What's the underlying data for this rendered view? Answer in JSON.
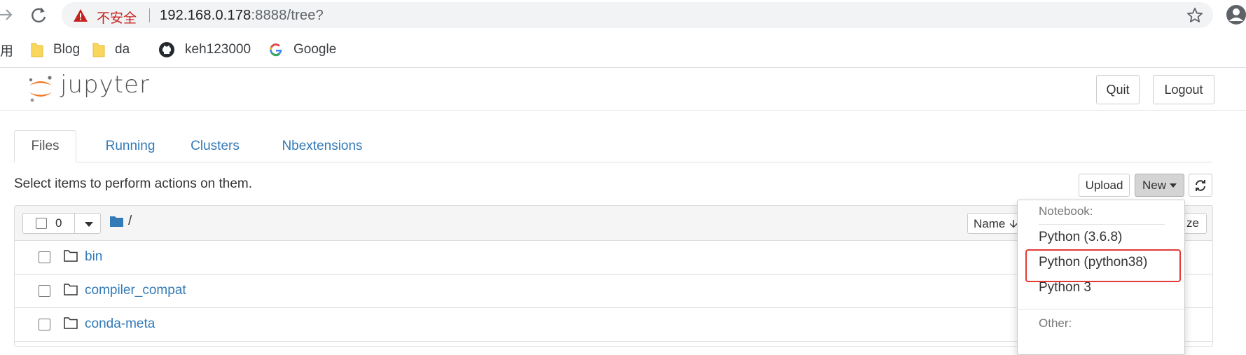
{
  "browser": {
    "security_label": "不安全",
    "url_host": "192.168.0.178",
    "url_rest": ":8888/tree?",
    "bookmarks": [
      {
        "label": "用",
        "icon": "apps-icon"
      },
      {
        "label": "Blog",
        "icon": "folder-icon"
      },
      {
        "label": "da",
        "icon": "folder-icon"
      },
      {
        "label": "keh123000",
        "icon": "github-icon"
      },
      {
        "label": "Google",
        "icon": "google-icon"
      }
    ]
  },
  "header": {
    "logo_text": "jupyter",
    "quit_label": "Quit",
    "logout_label": "Logout"
  },
  "tabs": [
    {
      "label": "Files",
      "active": true
    },
    {
      "label": "Running",
      "active": false
    },
    {
      "label": "Clusters",
      "active": false
    },
    {
      "label": "Nbextensions",
      "active": false
    }
  ],
  "toolbar": {
    "hint": "Select items to perform actions on them.",
    "upload_label": "Upload",
    "new_label": "New"
  },
  "list_header": {
    "selected_count": "0",
    "breadcrumb": "/",
    "name_label": "Name",
    "size_label": "ze"
  },
  "files": [
    {
      "name": "bin"
    },
    {
      "name": "compiler_compat"
    },
    {
      "name": "conda-meta"
    }
  ],
  "new_menu": {
    "notebook_header": "Notebook:",
    "kernels": [
      "Python (3.6.8)",
      "Python (python38)",
      "Python 3"
    ],
    "other_header": "Other:",
    "highlight_color": "#e53935"
  },
  "colors": {
    "link": "#337ab7",
    "jupyter_orange": "#f37726",
    "insecure_red": "#c5221f"
  }
}
